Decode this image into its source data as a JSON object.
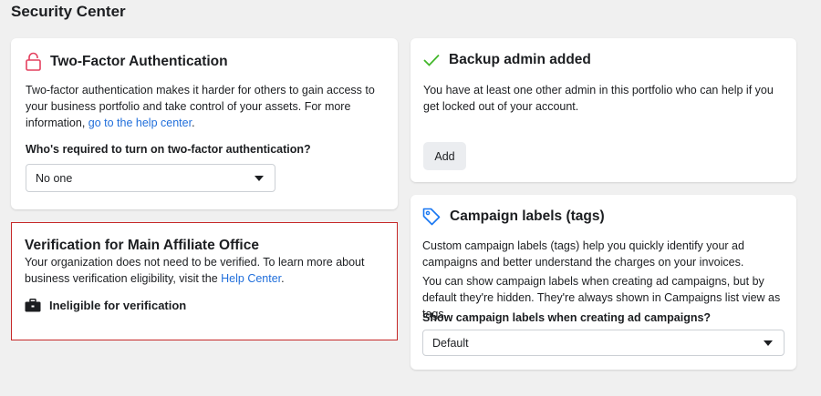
{
  "page": {
    "title": "Security Center"
  },
  "two_factor": {
    "title": "Two-Factor Authentication",
    "description": "Two-factor authentication makes it harder for others to gain access to your business portfolio and take control of your assets. For more information, ",
    "link": "go to the help center",
    "description_end": ".",
    "question": "Who's required to turn on two-factor authentication?",
    "selected": "No one",
    "icon": "lock-icon"
  },
  "verification": {
    "title": "Verification for Main Affiliate Office",
    "description": "Your organization does not need to be verified. To learn more about business verification eligibility, visit the ",
    "link": "Help Center",
    "description_end": ".",
    "status": "Ineligible for verification",
    "icon": "briefcase-icon",
    "border_color": "#c62828"
  },
  "backup_admin": {
    "title": "Backup admin added",
    "description": "You have at least one other admin in this portfolio who can help if you get locked out of your account.",
    "button": "Add",
    "icon": "checkmark-icon",
    "icon_color": "#42b72a"
  },
  "campaign_labels": {
    "title": "Campaign labels (tags)",
    "description1": "Custom campaign labels (tags) help you quickly identify your ad campaigns and better understand the charges on your invoices.",
    "description2": "You can show campaign labels when creating ad campaigns, but by default they're hidden. They're always shown in Campaigns list view as tags.",
    "question": "Show campaign labels when creating ad campaigns?",
    "selected": "Default",
    "icon": "tag-icon",
    "icon_color": "#1877f2"
  },
  "colors": {
    "link": "#216fdb",
    "lock": "#e4405f"
  }
}
